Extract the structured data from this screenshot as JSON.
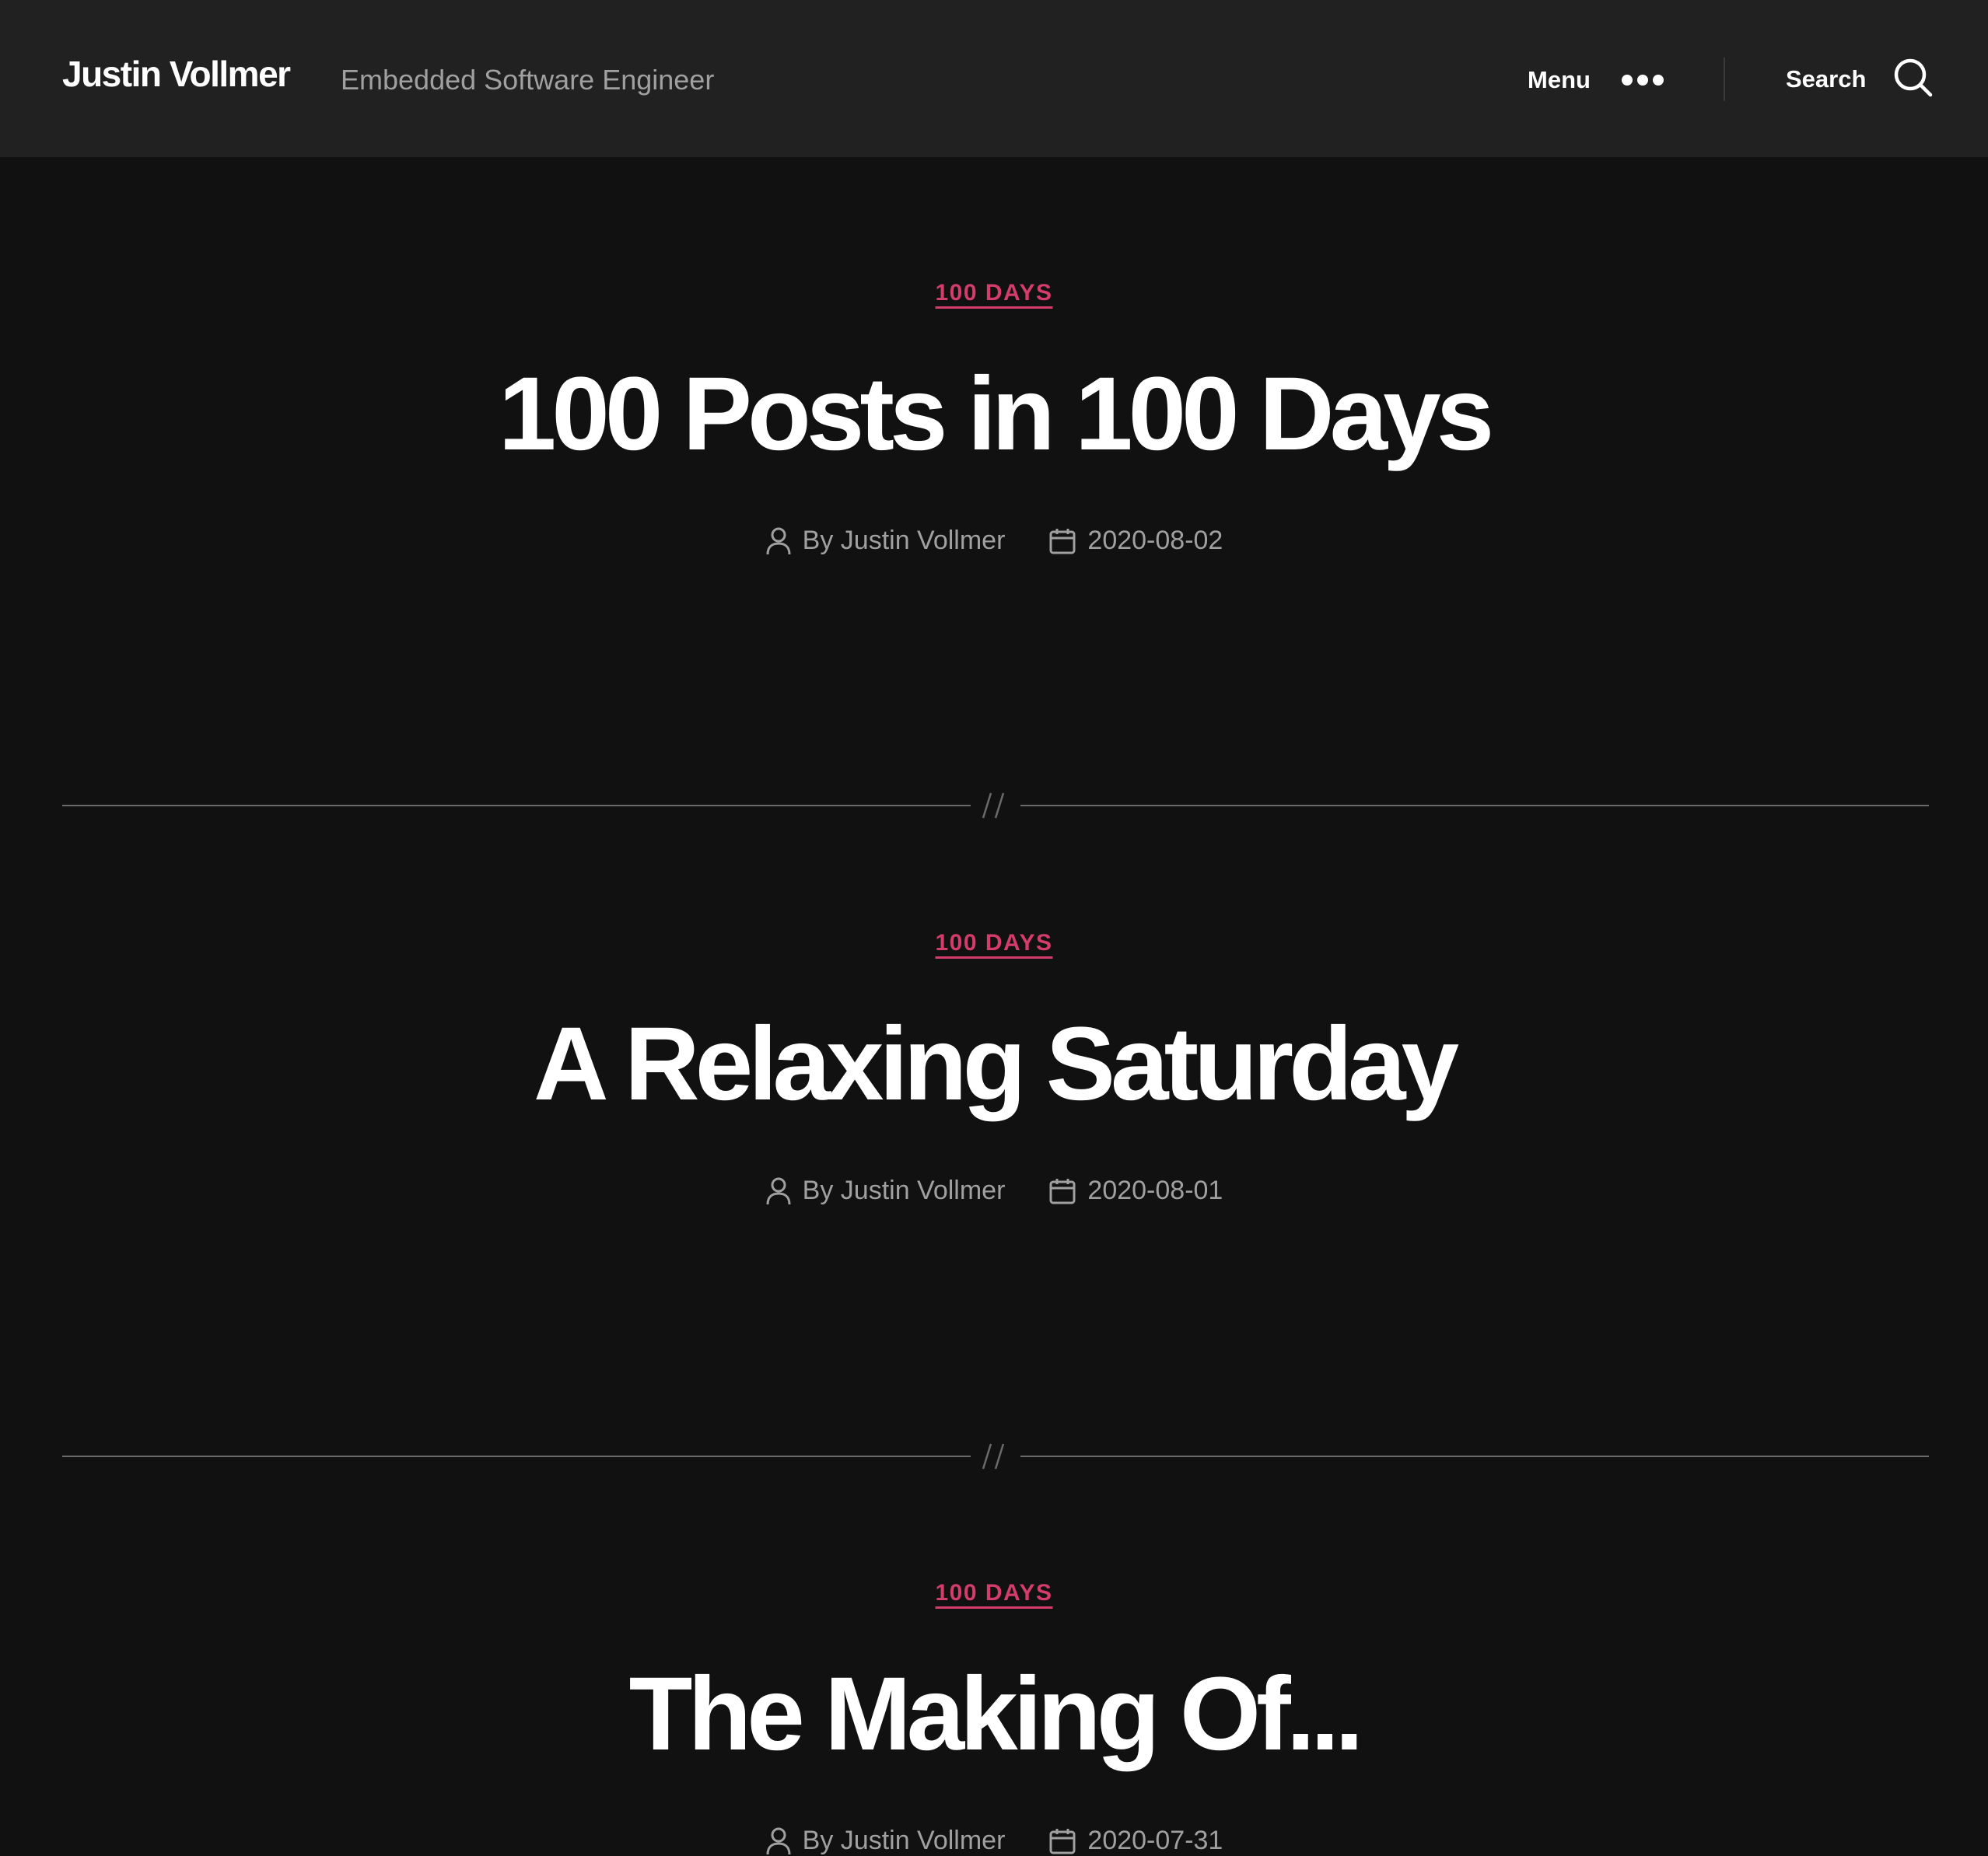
{
  "header": {
    "site_title": "Justin Vollmer",
    "tagline": "Embedded Software Engineer",
    "menu_label": "Menu",
    "search_label": "Search"
  },
  "posts": [
    {
      "category": "100 DAYS",
      "title": "100 Posts in 100 Days",
      "author": "By Justin Vollmer",
      "date": "2020-08-02"
    },
    {
      "category": "100 DAYS",
      "title": "A Relaxing Saturday",
      "author": "By Justin Vollmer",
      "date": "2020-08-01"
    },
    {
      "category": "100 DAYS",
      "title": "The Making Of...",
      "author": "By Justin Vollmer",
      "date": "2020-07-31"
    }
  ],
  "colors": {
    "background": "#111111",
    "header_background": "#212121",
    "accent": "#d33c6b",
    "meta_text": "#a0a0a0",
    "separator": "#6a6a6a"
  },
  "icons": {
    "menu": "more-dots-icon",
    "search": "search-icon",
    "author": "user-icon",
    "date": "calendar-icon",
    "separator": "double-slash-icon"
  }
}
